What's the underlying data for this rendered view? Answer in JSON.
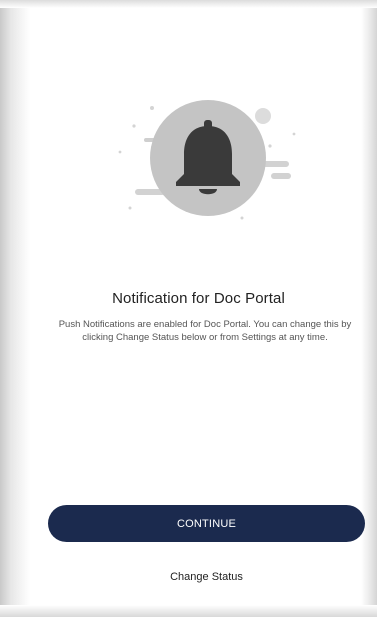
{
  "notification": {
    "title": "Notification for Doc Portal",
    "message": "Push Notifications are enabled for Doc Portal. You can change this by clicking Change Status below or from Settings at any time."
  },
  "actions": {
    "continue_label": "CONTINUE",
    "change_status_label": "Change Status"
  },
  "colors": {
    "primary_button": "#1b2a4e",
    "illustration_circle": "#c4c4c4",
    "bell": "#3a3a3a"
  },
  "icons": {
    "illustration": "bell-icon"
  }
}
